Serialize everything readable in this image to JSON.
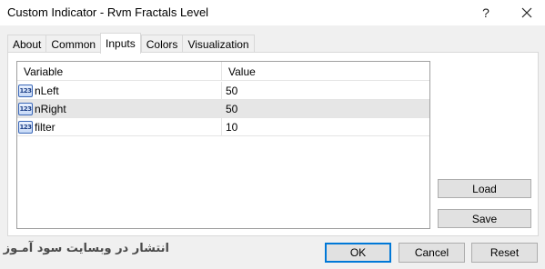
{
  "window": {
    "title": "Custom Indicator - Rvm Fractals Level",
    "help_label": "?",
    "close_icon": "close-icon"
  },
  "tabs": [
    {
      "label": "About",
      "active": false
    },
    {
      "label": "Common",
      "active": false
    },
    {
      "label": "Inputs",
      "active": true
    },
    {
      "label": "Colors",
      "active": false
    },
    {
      "label": "Visualization",
      "active": false
    }
  ],
  "grid": {
    "columns": [
      "Variable",
      "Value"
    ],
    "rows": [
      {
        "icon": "integer-type-icon",
        "icon_text": "123",
        "variable": "nLeft",
        "value": "50",
        "selected": false
      },
      {
        "icon": "integer-type-icon",
        "icon_text": "123",
        "variable": "nRight",
        "value": "50",
        "selected": true
      },
      {
        "icon": "integer-type-icon",
        "icon_text": "123",
        "variable": "filter",
        "value": "10",
        "selected": false
      }
    ]
  },
  "side_buttons": {
    "load": "Load",
    "save": "Save"
  },
  "footer": {
    "watermark": "انتشار در وبسایت سود آمـوز",
    "ok": "OK",
    "cancel": "Cancel",
    "reset": "Reset"
  },
  "colors": {
    "accent": "#0078d7",
    "selected_row": "#e6e6e6"
  }
}
